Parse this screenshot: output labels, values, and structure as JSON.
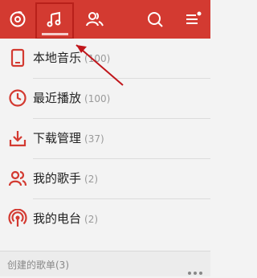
{
  "colors": {
    "accent": "#d33a31",
    "annotation": "#c0151a"
  },
  "topbar": {
    "tabs": [
      {
        "name": "discover",
        "icon": "disc-icon"
      },
      {
        "name": "music",
        "icon": "music-note-icon",
        "active": true
      },
      {
        "name": "friends",
        "icon": "friends-icon"
      },
      {
        "name": "search",
        "icon": "search-icon"
      },
      {
        "name": "menu",
        "icon": "menu-icon",
        "badge": true
      }
    ]
  },
  "list": {
    "items": [
      {
        "label": "本地音乐",
        "count": "(100)",
        "icon": "phone-icon"
      },
      {
        "label": "最近播放",
        "count": "(100)",
        "icon": "clock-icon"
      },
      {
        "label": "下载管理",
        "count": "(37)",
        "icon": "download-icon"
      },
      {
        "label": "我的歌手",
        "count": "(2)",
        "icon": "singer-icon"
      },
      {
        "label": "我的电台",
        "count": "(2)",
        "icon": "radio-icon"
      }
    ]
  },
  "section": {
    "title": "创建的歌单(3)",
    "more_icon": "more-dots-icon"
  }
}
